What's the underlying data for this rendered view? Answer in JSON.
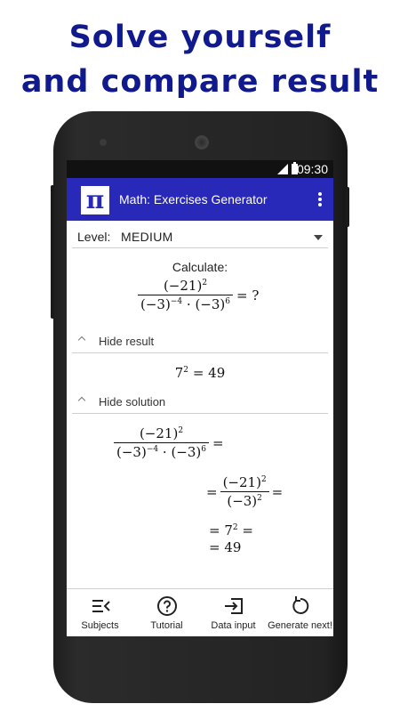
{
  "promo": {
    "line1": "Solve yourself",
    "line2": "and compare result"
  },
  "status_bar": {
    "time": "09:30",
    "icons": [
      "signal-icon",
      "battery-icon"
    ]
  },
  "app_bar": {
    "logo_glyph": "π",
    "title": "Math: Exercises Generator",
    "menu_icon": "overflow-menu-icon"
  },
  "level": {
    "label": "Level:",
    "value": "MEDIUM"
  },
  "exercise": {
    "prompt": "Calculate:",
    "numerator": "(−21)",
    "numerator_exp": "2",
    "den_a": "(−3)",
    "den_a_exp": "−4",
    "dot": "·",
    "den_b": "(−3)",
    "den_b_exp": "6",
    "rhs": "= ?"
  },
  "result_section": {
    "toggle_label": "Hide result",
    "base": "7",
    "exp": "2",
    "rhs": "= 49"
  },
  "solution_section": {
    "toggle_label": "Hide solution",
    "step1_num": "(−21)",
    "step1_num_exp": "2",
    "step1_den_a": "(−3)",
    "step1_den_a_exp": "−4",
    "step1_dot": "·",
    "step1_den_b": "(−3)",
    "step1_den_b_exp": "6",
    "eq": "=",
    "step2_num": "(−21)",
    "step2_num_exp": "2",
    "step2_den": "(−3)",
    "step2_den_exp": "2",
    "step3_pre": "= 7",
    "step3_exp": "2",
    "step3_post": "=",
    "step4": "= 49"
  },
  "bottom_nav": {
    "items": [
      {
        "label": "Subjects",
        "icon": "subjects-icon"
      },
      {
        "label": "Tutorial",
        "icon": "help-icon"
      },
      {
        "label": "Data input",
        "icon": "data-input-icon"
      },
      {
        "label": "Generate next!",
        "icon": "refresh-icon"
      }
    ]
  },
  "colors": {
    "headline": "#101a8c",
    "app_bar": "#2828b9",
    "status_bar": "#111111"
  }
}
